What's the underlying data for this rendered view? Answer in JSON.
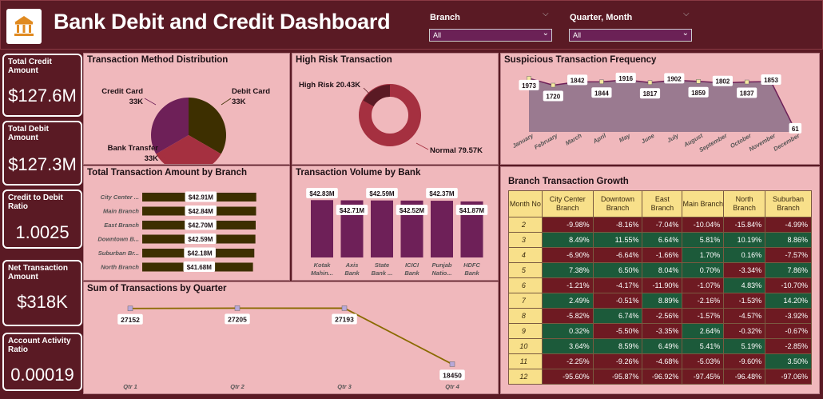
{
  "header": {
    "title": "Bank Debit and Credit Dashboard",
    "logo_icon": "bank-building-icon"
  },
  "slicers": {
    "branch": {
      "label": "Branch",
      "value": "All"
    },
    "quarter_month": {
      "label": "Quarter, Month",
      "value": "All"
    }
  },
  "kpis": [
    {
      "label": "Total Credit Amount",
      "value": "$127.6M"
    },
    {
      "label": "Total Debit Amount",
      "value": "$127.3M"
    },
    {
      "label": "Credit to Debit Ratio",
      "value": "1.0025"
    },
    {
      "label": "Net Transaction Amount",
      "value": "$318K"
    },
    {
      "label": "Account Activity Ratio",
      "value": "0.00019"
    }
  ],
  "panels": {
    "method": "Transaction Method Distribution",
    "risk": "High Risk Transaction",
    "suspicious": "Suspicious Transaction Frequency",
    "branch_amount": "Total Transaction Amount by Branch",
    "volume": "Transaction Volume by Bank",
    "quarter": "Sum of Transactions by Quarter",
    "growth": "Branch Transaction Growth"
  },
  "chart_data": [
    {
      "id": "method",
      "type": "pie",
      "slices": [
        {
          "name": "Debit Card",
          "value": 33,
          "label": "33K",
          "color": "#3d2f00"
        },
        {
          "name": "Bank Transfer",
          "value": 33,
          "label": "33K",
          "color": "#a53040"
        },
        {
          "name": "Credit Card",
          "value": 33,
          "label": "33K",
          "color": "#6e2058"
        }
      ]
    },
    {
      "id": "risk",
      "type": "pie",
      "slices": [
        {
          "name": "Normal",
          "value": 79.57,
          "label": "79.57K",
          "color": "#a53040"
        },
        {
          "name": "High Risk",
          "value": 20.43,
          "label": "20.43K",
          "color": "#5a1a24"
        }
      ]
    },
    {
      "id": "suspicious",
      "type": "area",
      "categories": [
        "January",
        "February",
        "March",
        "April",
        "May",
        "June",
        "July",
        "August",
        "September",
        "October",
        "November",
        "December"
      ],
      "values": [
        1973,
        1720,
        1842,
        1844,
        1916,
        1817,
        1902,
        1859,
        1802,
        1837,
        1853,
        61
      ],
      "colors": {
        "fill": "#9a7a90",
        "line": "#6e2058",
        "marker": "#f5e8a0"
      }
    },
    {
      "id": "branch_amount",
      "type": "bar",
      "categories": [
        "City Center ...",
        "Main Branch",
        "East Branch",
        "Downtown B...",
        "Suburban Br...",
        "North Branch"
      ],
      "values": [
        42.91,
        42.84,
        42.7,
        42.59,
        42.18,
        41.68
      ],
      "labels": [
        "$42.91M",
        "$42.84M",
        "$42.70M",
        "$42.59M",
        "$42.18M",
        "$41.68M"
      ],
      "color": "#3d2f00"
    },
    {
      "id": "volume",
      "type": "bar",
      "categories": [
        "Kotak Mahin...",
        "Axis Bank",
        "State Bank ...",
        "ICICI Bank",
        "Punjab Natio...",
        "HDFC Bank"
      ],
      "values": [
        42.83,
        42.71,
        42.59,
        42.52,
        42.37,
        41.87
      ],
      "labels": [
        "$42.83M",
        "$42.71M",
        "$42.59M",
        "$42.52M",
        "$42.37M",
        "$41.87M"
      ],
      "color": "#6e2058"
    },
    {
      "id": "quarter",
      "type": "line",
      "categories": [
        "Qtr 1",
        "Qtr 2",
        "Qtr 3",
        "Qtr 4"
      ],
      "values": [
        27152,
        27205,
        27193,
        18450
      ],
      "colors": {
        "line": "#8a6a00",
        "marker": "#b8a8d8"
      }
    }
  ],
  "growth_table": {
    "headers": [
      "Month No",
      "City Center Branch",
      "Downtown Branch",
      "East Branch",
      "Main Branch",
      "North Branch",
      "Suburban Branch"
    ],
    "rows": [
      [
        "2",
        "-9.98%",
        "-8.16%",
        "-7.04%",
        "-10.04%",
        "-15.84%",
        "-4.99%"
      ],
      [
        "3",
        "8.49%",
        "11.55%",
        "6.64%",
        "5.81%",
        "10.19%",
        "8.86%"
      ],
      [
        "4",
        "-6.90%",
        "-6.64%",
        "-1.66%",
        "1.70%",
        "0.16%",
        "-7.57%"
      ],
      [
        "5",
        "7.38%",
        "6.50%",
        "8.04%",
        "0.70%",
        "-3.34%",
        "7.86%"
      ],
      [
        "6",
        "-1.21%",
        "-4.17%",
        "-11.90%",
        "-1.07%",
        "4.83%",
        "-10.70%"
      ],
      [
        "7",
        "2.49%",
        "-0.51%",
        "8.89%",
        "-2.16%",
        "-1.53%",
        "14.20%"
      ],
      [
        "8",
        "-5.82%",
        "6.74%",
        "-2.56%",
        "-1.57%",
        "-4.57%",
        "-3.92%"
      ],
      [
        "9",
        "0.32%",
        "-5.50%",
        "-3.35%",
        "2.64%",
        "-0.32%",
        "-0.67%"
      ],
      [
        "10",
        "3.64%",
        "8.59%",
        "6.49%",
        "5.41%",
        "5.19%",
        "-2.85%"
      ],
      [
        "11",
        "-2.25%",
        "-9.26%",
        "-4.68%",
        "-5.03%",
        "-9.60%",
        "3.50%"
      ],
      [
        "12",
        "-95.60%",
        "-95.87%",
        "-96.92%",
        "-97.45%",
        "-96.48%",
        "-97.06%"
      ]
    ]
  }
}
